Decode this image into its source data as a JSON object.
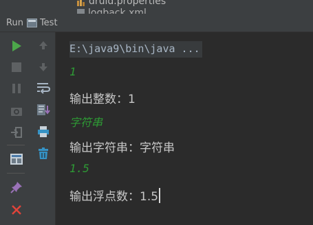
{
  "project_tree": {
    "file1": "druid.properties",
    "file2": "logback.xml"
  },
  "header": {
    "run_label": "Run",
    "tab_label": "Test"
  },
  "toolbar": {
    "run_icon": "play-icon",
    "stop_icon": "stop-icon",
    "pause_icon": "pause-icon",
    "dump_icon": "camera-icon",
    "exit_icon": "exit-icon",
    "layout_icon": "layout-icon",
    "pin_icon": "pin-icon",
    "close_icon": "close-icon",
    "up_icon": "arrow-up-icon",
    "down_icon": "arrow-down-icon",
    "wrap_icon": "soft-wrap-icon",
    "scroll_end_icon": "scroll-to-end-icon",
    "print_icon": "print-icon",
    "trash_icon": "trash-icon"
  },
  "console": {
    "command": "E:\\java9\\bin\\java ...",
    "lines": [
      "1",
      "输出整数：1",
      "字符串",
      "输出字符串：字符串",
      "1.5",
      "输出浮点数：1.5"
    ]
  },
  "colors": {
    "input_green": "#2e9a35",
    "run_green": "#4ca74a",
    "close_red": "#e0433a",
    "background": "#2b2b2b"
  }
}
